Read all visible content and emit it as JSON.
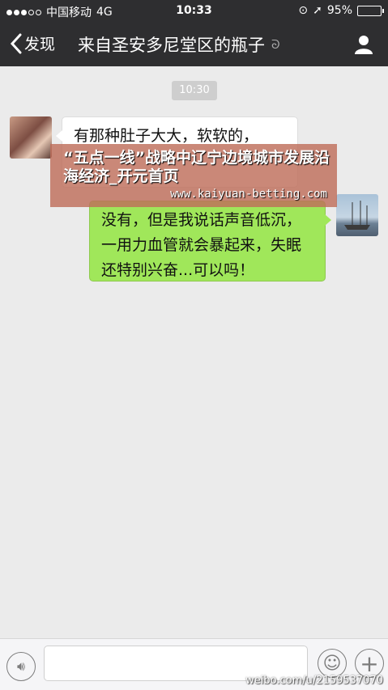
{
  "status_bar": {
    "carrier": "中国移动",
    "network": "4G",
    "time": "10:33",
    "battery_percent": "95%",
    "battery_level": 0.95
  },
  "nav": {
    "back_label": "发现",
    "title": "来自圣安多尼堂区的瓶子"
  },
  "chat": {
    "timestamp": "10:30",
    "messages": [
      {
        "side": "left",
        "text": "有那种肚子大大，软软的，"
      },
      {
        "side": "right",
        "text": "没有，但是我说话声音低沉，一用力血管就会暴起来，失眠还特别兴奋...可以吗！"
      }
    ]
  },
  "watermark": {
    "title": "“五点一线”战略中辽宁边境城市发展沿海经济_开元首页",
    "url": "www.kaiyuan-betting.com"
  },
  "credit": "weibo.com/u/2159537070",
  "colors": {
    "nav_bg": "#2e2e30",
    "chat_bg": "#ebebeb",
    "bubble_green": "#a0e75a",
    "battery_green": "#4cd964"
  }
}
